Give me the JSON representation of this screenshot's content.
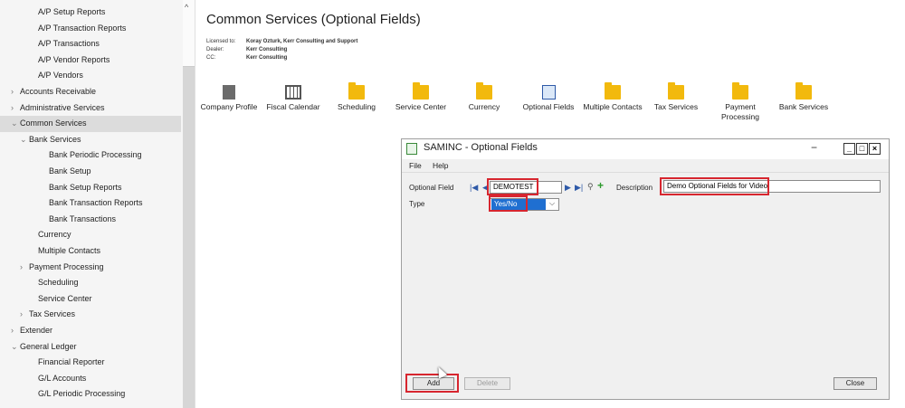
{
  "sidebar": {
    "items": [
      {
        "label": "A/P Setup Reports",
        "level": 2,
        "chevron": ""
      },
      {
        "label": "A/P Transaction Reports",
        "level": 2,
        "chevron": ""
      },
      {
        "label": "A/P Transactions",
        "level": 2,
        "chevron": ""
      },
      {
        "label": "A/P Vendor Reports",
        "level": 2,
        "chevron": ""
      },
      {
        "label": "A/P Vendors",
        "level": 2,
        "chevron": ""
      },
      {
        "label": "Accounts Receivable",
        "level": 0,
        "chevron": "›"
      },
      {
        "label": "Administrative Services",
        "level": 0,
        "chevron": "›"
      },
      {
        "label": "Common Services",
        "level": 0,
        "chevron": "⌄",
        "selected": true
      },
      {
        "label": "Bank Services",
        "level": 1,
        "chevron": "⌄"
      },
      {
        "label": "Bank Periodic Processing",
        "level": 3,
        "chevron": ""
      },
      {
        "label": "Bank Setup",
        "level": 3,
        "chevron": ""
      },
      {
        "label": "Bank Setup Reports",
        "level": 3,
        "chevron": ""
      },
      {
        "label": "Bank Transaction Reports",
        "level": 3,
        "chevron": ""
      },
      {
        "label": "Bank Transactions",
        "level": 3,
        "chevron": ""
      },
      {
        "label": "Currency",
        "level": 2,
        "chevron": ""
      },
      {
        "label": "Multiple Contacts",
        "level": 2,
        "chevron": ""
      },
      {
        "label": "Payment Processing",
        "level": 1,
        "chevron": "›"
      },
      {
        "label": "Scheduling",
        "level": 2,
        "chevron": ""
      },
      {
        "label": "Service Center",
        "level": 2,
        "chevron": ""
      },
      {
        "label": "Tax Services",
        "level": 1,
        "chevron": "›"
      },
      {
        "label": "Extender",
        "level": 0,
        "chevron": "›"
      },
      {
        "label": "General Ledger",
        "level": 0,
        "chevron": "⌄"
      },
      {
        "label": "Financial Reporter",
        "level": 2,
        "chevron": ""
      },
      {
        "label": "G/L Accounts",
        "level": 2,
        "chevron": ""
      },
      {
        "label": "G/L Periodic Processing",
        "level": 2,
        "chevron": ""
      }
    ],
    "scroll_up_glyph": "^"
  },
  "main": {
    "title": "Common Services (Optional Fields)",
    "license": {
      "licensed_to_label": "Licensed to:",
      "licensed_to_value": "Koray Ozturk, Kerr Consulting and Support",
      "dealer_label": "Dealer:",
      "dealer_value": "Kerr Consulting",
      "cc_label": "CC:",
      "cc_value": "Kerr Consulting"
    },
    "modules": [
      {
        "label": "Company Profile",
        "icon": "building-icon"
      },
      {
        "label": "Fiscal Calendar",
        "icon": "calendar-icon"
      },
      {
        "label": "Scheduling",
        "icon": "folder-icon"
      },
      {
        "label": "Service Center",
        "icon": "folder-icon"
      },
      {
        "label": "Currency",
        "icon": "folder-icon"
      },
      {
        "label": "Optional Fields",
        "icon": "optional-fields-icon"
      },
      {
        "label": "Multiple Contacts",
        "icon": "folder-icon"
      },
      {
        "label": "Tax Services",
        "icon": "folder-icon"
      },
      {
        "label": "Payment\nProcessing",
        "icon": "folder-icon"
      },
      {
        "label": "Bank Services",
        "icon": "folder-icon"
      }
    ]
  },
  "dialog": {
    "title": "SAMINC - Optional Fields",
    "minimize_glyph": "−",
    "window_buttons": [
      "_",
      "□",
      "×"
    ],
    "menu": {
      "file": "File",
      "help": "Help"
    },
    "optional_field_label": "Optional Field",
    "optional_field_value": "DEMOTEST",
    "description_label": "Description",
    "description_value": "Demo Optional Fields for Video",
    "type_label": "Type",
    "type_value": "Yes/No",
    "add_button": "Add",
    "delete_button": "Delete",
    "close_button": "Close",
    "nav_first": "|◀",
    "nav_prev": "◀",
    "nav_next": "▶",
    "nav_last": "▶|",
    "finder_glyph": "⚲",
    "new_glyph": "+",
    "dropdown_glyph": "⌵"
  },
  "colors": {
    "highlight_red": "#d7262f",
    "folder_yellow": "#f2b90d",
    "selection_blue": "#1f6fd1"
  }
}
